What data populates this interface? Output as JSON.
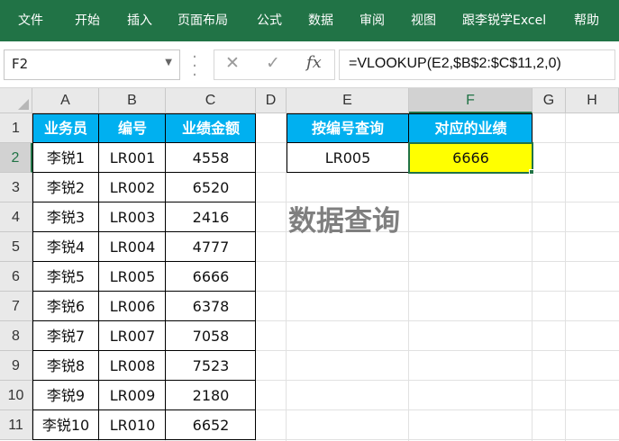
{
  "ribbon": {
    "tabs": [
      "文件",
      "开始",
      "插入",
      "页面布局",
      "公式",
      "数据",
      "审阅",
      "视图",
      "跟李锐学Excel",
      "帮助"
    ]
  },
  "formula_bar": {
    "name_box": "F2",
    "formula": "=VLOOKUP(E2,$B$2:$C$11,2,0)",
    "cancel_symbol": "✕",
    "enter_symbol": "✓",
    "fx_label": "fx"
  },
  "sheet": {
    "columns": [
      "A",
      "B",
      "C",
      "D",
      "E",
      "F",
      "G",
      "H"
    ],
    "rows": [
      "1",
      "2",
      "3",
      "4",
      "5",
      "6",
      "7",
      "8",
      "9",
      "10",
      "11"
    ],
    "active_cell": "F2",
    "table_headers": [
      "业务员",
      "编号",
      "业绩金额"
    ],
    "table_rows": [
      [
        "李锐1",
        "LR001",
        "4558"
      ],
      [
        "李锐2",
        "LR002",
        "6520"
      ],
      [
        "李锐3",
        "LR003",
        "2416"
      ],
      [
        "李锐4",
        "LR004",
        "4777"
      ],
      [
        "李锐5",
        "LR005",
        "6666"
      ],
      [
        "李锐6",
        "LR006",
        "6378"
      ],
      [
        "李锐7",
        "LR007",
        "7058"
      ],
      [
        "李锐8",
        "LR008",
        "7523"
      ],
      [
        "李锐9",
        "LR009",
        "2180"
      ],
      [
        "李锐10",
        "LR010",
        "6652"
      ]
    ],
    "lookup_headers": [
      "按编号查询",
      "对应的业绩"
    ],
    "lookup_values": [
      "LR005",
      "6666"
    ],
    "overlay_title": "数据查询"
  },
  "colors": {
    "ribbon": "#217346",
    "header_fill": "#00b0f0",
    "result_fill": "#ffff00",
    "selection": "#217346"
  }
}
